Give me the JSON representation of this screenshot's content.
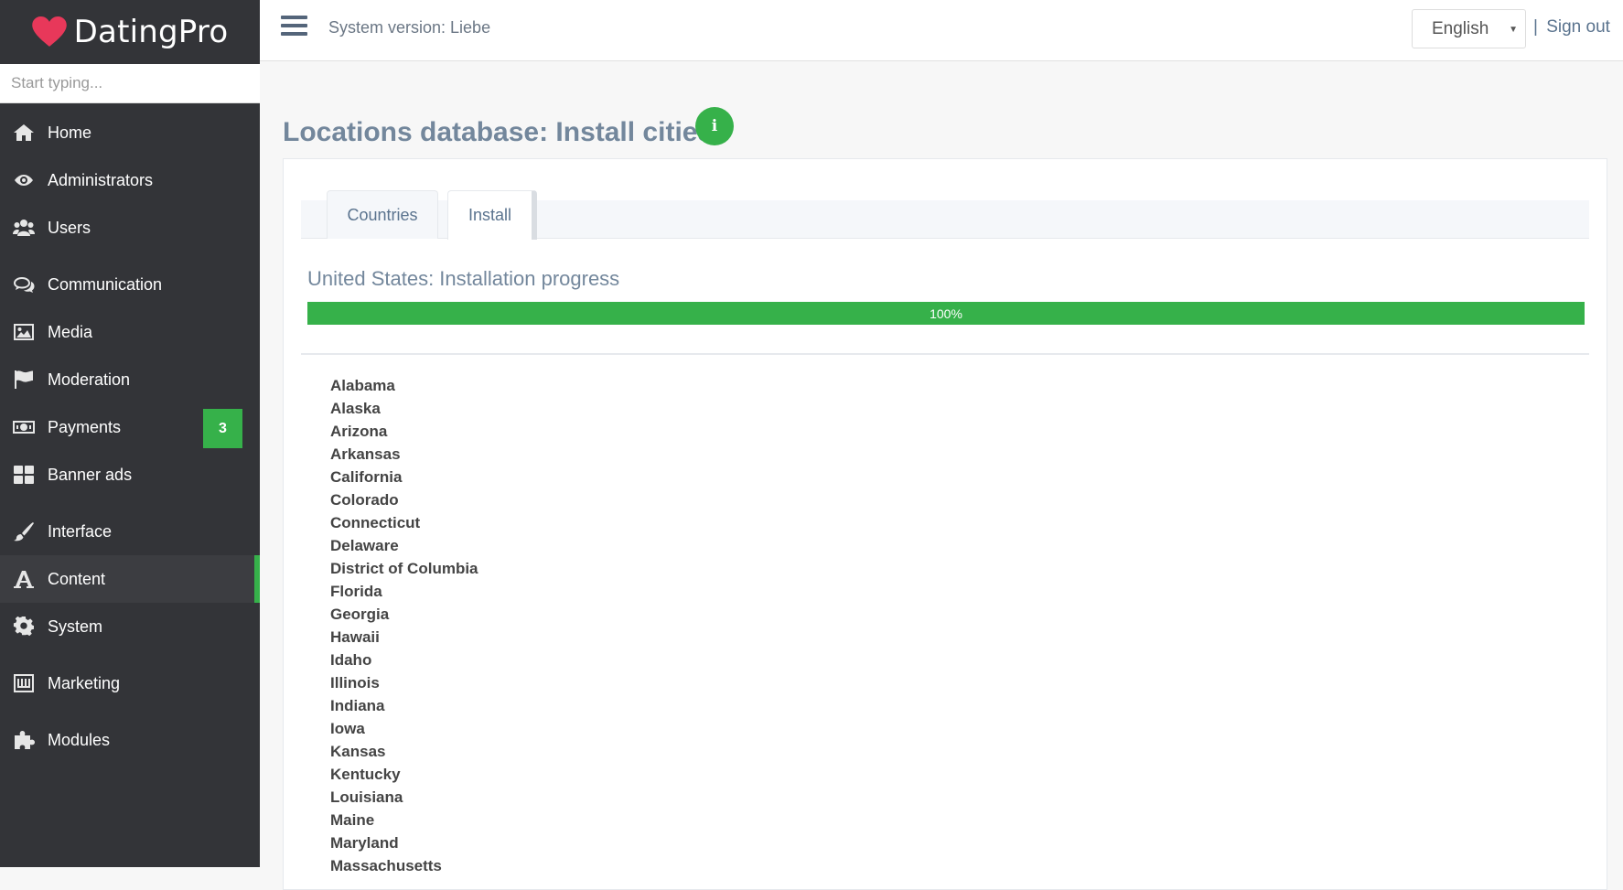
{
  "brand": {
    "name": "DatingPro",
    "logo_icon": "heart-icon",
    "logo_color": "#e8385a"
  },
  "search": {
    "placeholder": "Start typing..."
  },
  "sidebar": {
    "items": [
      {
        "label": "Home",
        "icon": "home-icon"
      },
      {
        "label": "Administrators",
        "icon": "eye-icon"
      },
      {
        "label": "Users",
        "icon": "users-icon"
      },
      {
        "label": "Communication",
        "icon": "chat-icon"
      },
      {
        "label": "Media",
        "icon": "image-icon"
      },
      {
        "label": "Moderation",
        "icon": "flag-icon"
      },
      {
        "label": "Payments",
        "icon": "money-icon",
        "badge": "3"
      },
      {
        "label": "Banner ads",
        "icon": "grid-icon"
      },
      {
        "label": "Interface",
        "icon": "brush-icon"
      },
      {
        "label": "Content",
        "icon": "font-icon",
        "active": true
      },
      {
        "label": "System",
        "icon": "gear-icon"
      },
      {
        "label": "Marketing",
        "icon": "inbox-icon"
      },
      {
        "label": "Modules",
        "icon": "puzzle-icon"
      }
    ]
  },
  "topbar": {
    "system_version": "System version: Liebe",
    "language": "English",
    "separator": "|",
    "sign_out": "Sign out"
  },
  "main": {
    "title": "Locations database: Install cities",
    "info_icon": "info-icon",
    "tabs": [
      {
        "label": "Countries"
      },
      {
        "label": "Install",
        "active": true
      }
    ],
    "progress": {
      "heading": "United States: Installation progress",
      "percent": 100,
      "label": "100%"
    },
    "states": [
      "Alabama",
      "Alaska",
      "Arizona",
      "Arkansas",
      "California",
      "Colorado",
      "Connecticut",
      "Delaware",
      "District of Columbia",
      "Florida",
      "Georgia",
      "Hawaii",
      "Idaho",
      "Illinois",
      "Indiana",
      "Iowa",
      "Kansas",
      "Kentucky",
      "Louisiana",
      "Maine",
      "Maryland",
      "Massachusetts"
    ]
  },
  "colors": {
    "accent": "#36b14a",
    "sidebar_bg": "#333438",
    "heading": "#73879c"
  }
}
